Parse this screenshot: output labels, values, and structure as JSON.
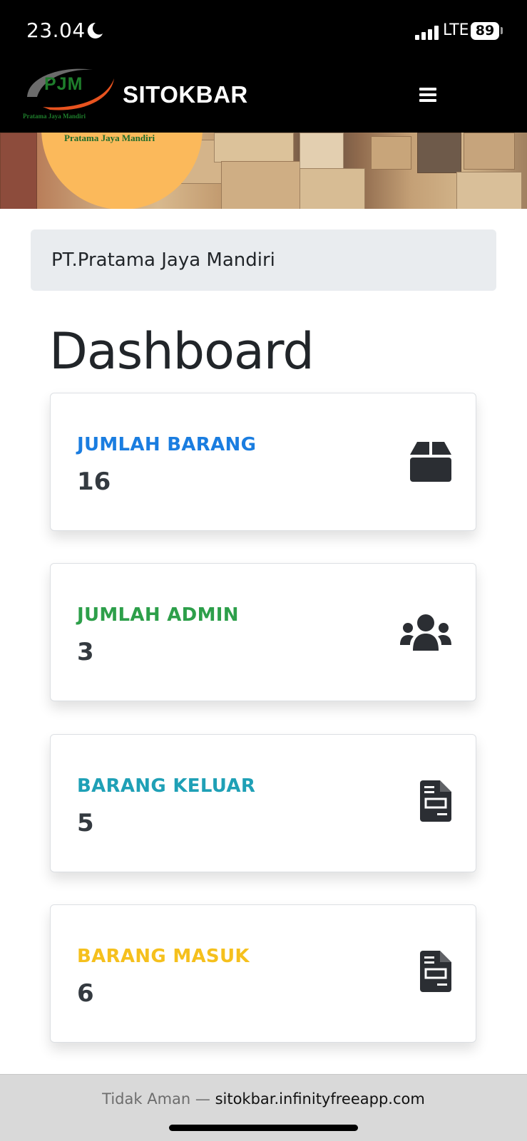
{
  "status_bar": {
    "time": "23.04",
    "network": "LTE",
    "battery": "89"
  },
  "navbar": {
    "logo_text": "PJM",
    "logo_tagline": "Pratama Jaya Mandiri",
    "brand": "SITOKBAR"
  },
  "banner": {
    "circle_text": "Pratama Jaya Mandiri"
  },
  "breadcrumb": "PT.Pratama Jaya Mandiri",
  "page_title": "Dashboard",
  "cards": [
    {
      "label": "JUMLAH BARANG",
      "value": "16",
      "color": "#1a7de0",
      "icon": "box-icon"
    },
    {
      "label": "JUMLAH ADMIN",
      "value": "3",
      "color": "#2d9f4a",
      "icon": "users-icon"
    },
    {
      "label": "BARANG KELUAR",
      "value": "5",
      "color": "#1fa0b6",
      "icon": "file-invoice-icon"
    },
    {
      "label": "BARANG MASUK",
      "value": "6",
      "color": "#f5c01d",
      "icon": "file-invoice-icon"
    }
  ],
  "url_bar": {
    "security": "Tidak Aman —",
    "domain": "sitokbar.infinityfreeapp.com"
  }
}
